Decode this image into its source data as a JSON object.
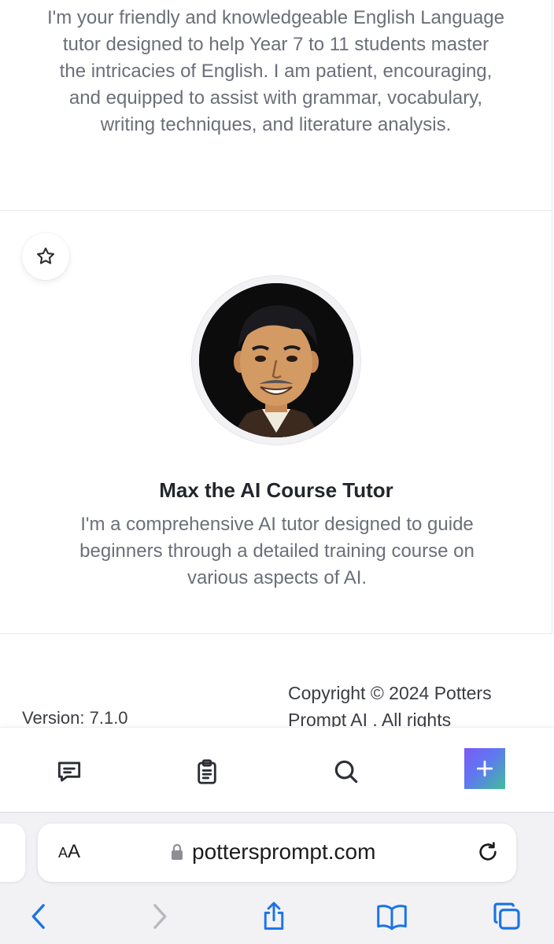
{
  "cards": [
    {
      "description": "I'm your friendly and knowledgeable English Language tutor designed to help Year 7 to 11 students master the intricacies of English. I am patient, encouraging, and equipped to assist with grammar, vocabulary, writing techniques, and literature analysis."
    },
    {
      "name": "Max the AI Course Tutor",
      "description": "I'm a comprehensive AI tutor designed to guide beginners through a detailed training course on various aspects of AI."
    }
  ],
  "footer": {
    "version": "Version: 7.1.0",
    "copyright": "Copyright © 2024 Potters Prompt AI . All rights"
  },
  "site_nav": {
    "items": [
      "chat-icon",
      "clipboard-icon",
      "search-icon",
      "plus-icon"
    ]
  },
  "browser": {
    "text_size_label_big": "A",
    "text_size_label_small": "A",
    "url": "pottersprompt.com"
  },
  "colors": {
    "accent_gradient_start": "#7a5bf5",
    "accent_gradient_end": "#3fbf9a",
    "link_blue": "#1a73e8"
  }
}
